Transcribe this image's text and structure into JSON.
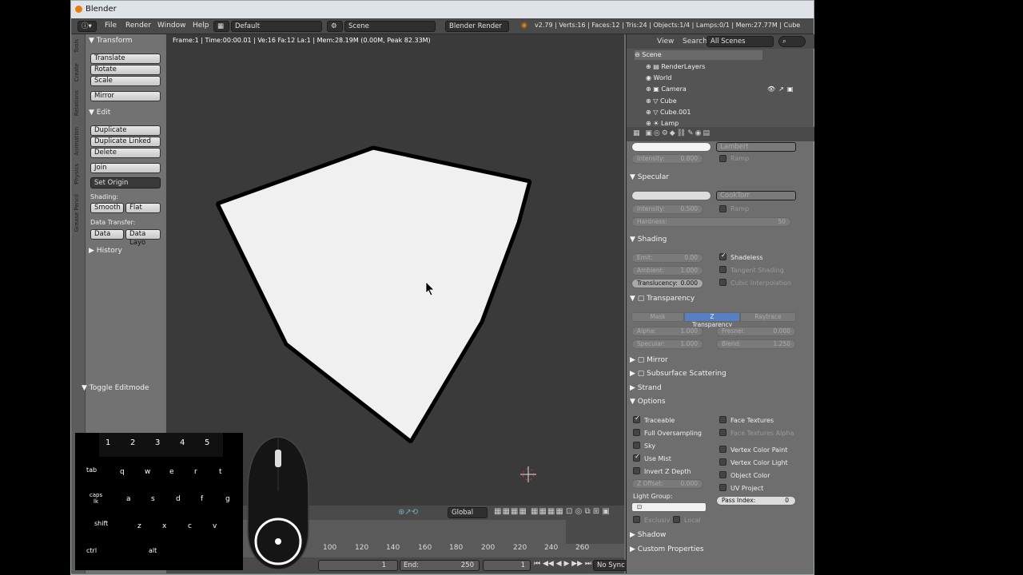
{
  "window": {
    "title": "Blender"
  },
  "menu": {
    "items": [
      "File",
      "Render",
      "Window",
      "Help"
    ],
    "layout": "Default",
    "scene": "Scene",
    "engine": "Blender Render",
    "stats": "v2.79 | Verts:16 | Faces:12 | Tris:24 | Objects:1/4 | Lamps:0/1 | Mem:27.77M | Cube"
  },
  "toolbar": {
    "tabs": [
      "Tools",
      "Create",
      "Relations",
      "Animation",
      "Physics",
      "Grease Pencil"
    ],
    "transform_header": "Transform",
    "translate": "Translate",
    "rotate": "Rotate",
    "scale": "Scale",
    "mirror": "Mirror",
    "edit_header": "Edit",
    "duplicate": "Duplicate",
    "duplicate_linked": "Duplicate Linked",
    "delete": "Delete",
    "join": "Join",
    "set_origin": "Set Origin",
    "shading_label": "Shading:",
    "smooth": "Smooth",
    "flat": "Flat",
    "data_transfer_label": "Data Transfer:",
    "data": "Data",
    "data_layo": "Data Layo",
    "history": "History",
    "toggle_editmode": "Toggle Editmode"
  },
  "viewport": {
    "info": "Frame:1 | Time:00:00.01 | Ve:16 Fa:12 La:1 | Mem:28.19M (0.00M, Peak 82.33M)",
    "orientation": "Global"
  },
  "timeline": {
    "ticks": [
      "100",
      "120",
      "140",
      "160",
      "180",
      "200",
      "220",
      "240",
      "260"
    ],
    "end_label": "End:",
    "end_value": "250",
    "frame": "1",
    "start_value": "1",
    "sync": "No Sync"
  },
  "outliner": {
    "view": "View",
    "search": "Search",
    "filter": "All Scenes",
    "rows": [
      "Scene",
      "RenderLayers",
      "World",
      "Camera",
      "Cube",
      "Cube.001",
      "Lamp"
    ]
  },
  "properties": {
    "diffuse_shader": "Lambert",
    "intensity_label": "Intensity:",
    "intensity": "0.800",
    "ramp": "Ramp",
    "specular_header": "Specular",
    "spec_shader": "CookTorr",
    "spec_intensity": "0.500",
    "hardness_label": "Hardness:",
    "hardness": "50",
    "shading_header": "Shading",
    "emit_label": "Emit:",
    "emit": "0.00",
    "ambient_label": "Ambient:",
    "ambient": "1.000",
    "translucency_label": "Translucency:",
    "translucency": "0.000",
    "shadeless": "Shadeless",
    "tangent": "Tangent Shading",
    "cubic": "Cubic Interpolation",
    "transparency_header": "Transparency",
    "mask": "Mask",
    "z_transparency": "Z Transparency",
    "raytrace": "Raytrace",
    "alpha_label": "Alpha:",
    "alpha": "1.000",
    "fresnel_label": "Fresnel:",
    "fresnel": "0.000",
    "specular_label": "Specular:",
    "specular_val": "1.000",
    "blend_label": "Blend:",
    "blend": "1.250",
    "mirror_header": "Mirror",
    "sss_header": "Subsurface Scattering",
    "strand_header": "Strand",
    "options_header": "Options",
    "traceable": "Traceable",
    "full_oversampling": "Full Oversampling",
    "sky": "Sky",
    "use_mist": "Use Mist",
    "invert_z": "Invert Z Depth",
    "z_offset_label": "Z Offset:",
    "z_offset": "0.000",
    "light_group": "Light Group:",
    "exclusive": "Exclusiv",
    "local": "Local",
    "face_textures": "Face Textures",
    "face_textures_alpha": "Face Textures Alpha",
    "vc_paint": "Vertex Color Paint",
    "vc_light": "Vertex Color Light",
    "object_color": "Object Color",
    "uv_project": "UV Project",
    "pass_index_label": "Pass Index:",
    "pass_index": "0",
    "shadow_header": "Shadow",
    "custom_props": "Custom Properties"
  },
  "keyboard": {
    "row1": [
      "1",
      "2",
      "3",
      "4",
      "5"
    ],
    "row2": [
      "tab",
      "q",
      "w",
      "e",
      "r",
      "t"
    ],
    "row3": [
      "caps lk",
      "a",
      "s",
      "d",
      "f",
      "g"
    ],
    "row4": [
      "shift",
      "z",
      "x",
      "c",
      "v"
    ],
    "row5": [
      "ctrl",
      "alt"
    ]
  },
  "colors": {
    "accent": "#5680c2",
    "orange": "#e87d0d",
    "blender_bg": "#727272"
  }
}
